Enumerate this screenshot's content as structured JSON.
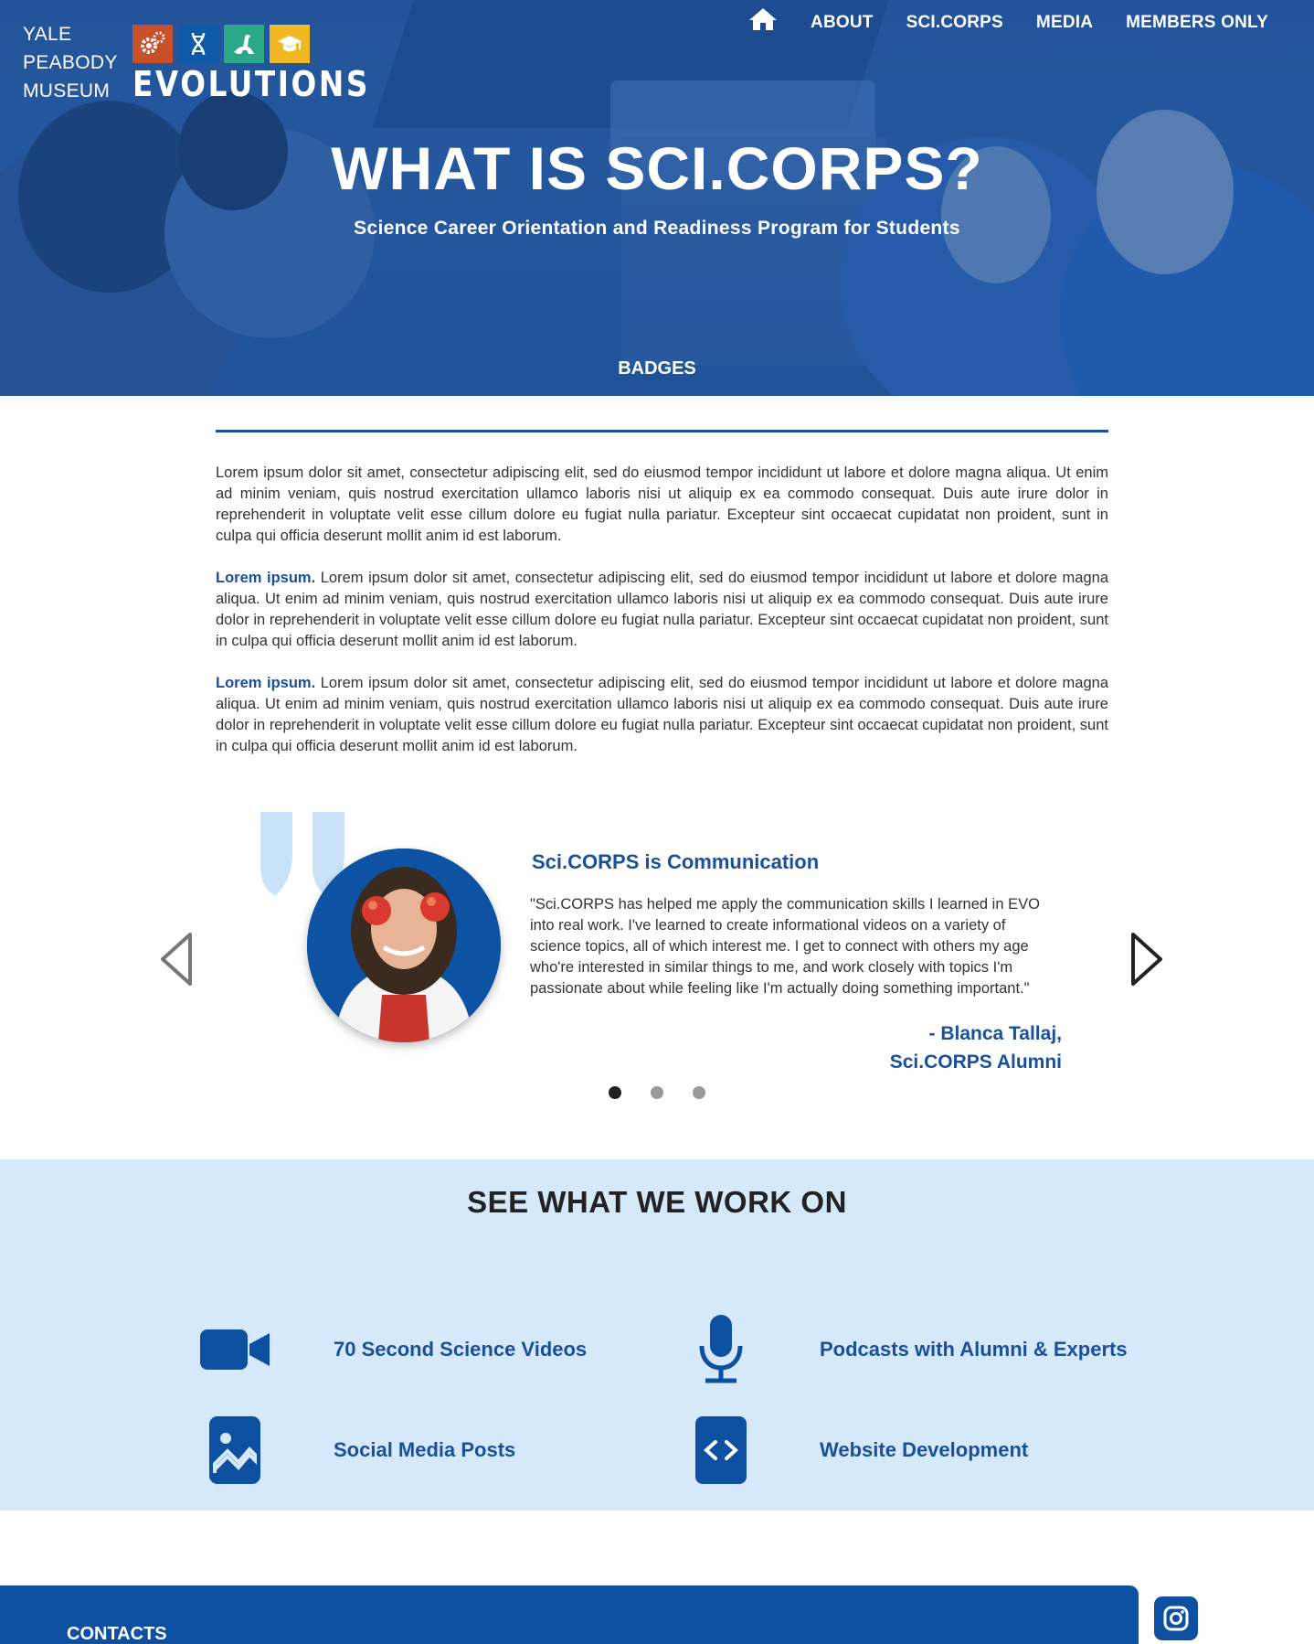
{
  "header": {
    "brand_lines": [
      "YALE",
      "PEABODY",
      "MUSEUM"
    ],
    "logo_word": "EVOLUTIONS",
    "tiles": [
      {
        "icon": "gears-icon",
        "color": "#c8502a"
      },
      {
        "icon": "dna-icon",
        "color": "#0e5aa8"
      },
      {
        "icon": "dinosaur-icon",
        "color": "#2aa887"
      },
      {
        "icon": "graduation-cap-icon",
        "color": "#f2b823"
      }
    ],
    "nav": {
      "home_icon": "home-icon",
      "items": [
        "ABOUT",
        "SCI.CORPS",
        "MEDIA",
        "MEMBERS ONLY"
      ]
    }
  },
  "hero": {
    "title": "WHAT IS SCI.CORPS?",
    "subtitle": "Science Career Orientation and Readiness Program for Students",
    "badges_label": "BADGES"
  },
  "intro": {
    "paragraph1": "Lorem ipsum dolor sit amet, consectetur adipiscing elit, sed do eiusmod tempor incididunt ut labore et dolore magna aliqua. Ut enim ad minim veniam, quis nostrud exercitation ullamco laboris nisi ut aliquip ex ea commodo consequat. Duis aute irure dolor in reprehenderit in voluptate velit esse cillum dolore eu fugiat nulla pariatur. Excepteur sint occaecat cupidatat non proident, sunt in culpa qui officia deserunt mollit anim id est laborum.",
    "paragraph2_lead": "Lorem ipsum.",
    "paragraph2": " Lorem ipsum dolor sit amet, consectetur adipiscing elit, sed do eiusmod tempor incididunt ut labore et dolore magna aliqua. Ut enim ad minim veniam, quis nostrud exercitation ullamco laboris nisi ut aliquip ex ea commodo consequat. Duis aute irure dolor in reprehenderit in voluptate velit esse cillum dolore eu fugiat nulla pariatur. Excepteur sint occaecat cupidatat non proident, sunt in culpa qui officia deserunt mollit anim id est laborum.",
    "paragraph3_lead": "Lorem ipsum.",
    "paragraph3": " Lorem ipsum dolor sit amet, consectetur adipiscing elit, sed do eiusmod tempor incididunt ut labore et dolore magna aliqua. Ut enim ad minim veniam, quis nostrud exercitation ullamco laboris nisi ut aliquip ex ea commodo consequat. Duis aute irure dolor in reprehenderit in voluptate velit esse cillum dolore eu fugiat nulla pariatur. Excepteur sint occaecat cupidatat non proident, sunt in culpa qui officia deserunt mollit anim id est laborum."
  },
  "testimonial": {
    "title": "Sci.CORPS is Communication",
    "quote": "\"Sci.CORPS has helped me apply the communication skills I learned in EVO into real work. I've learned to create informational videos on a variety of science topics, all of which interest me. I get to connect with others my age who're interested in similar things to me, and work closely with topics I'm passionate about while feeling like I'm actually doing something important.\"",
    "author_line1": "- Blanca Tallaj,",
    "author_line2": "Sci.CORPS Alumni",
    "slide_count": 3,
    "active_slide": 1
  },
  "work": {
    "title": "SEE WHAT WE WORK ON",
    "items": [
      {
        "label": "70 Second Science Videos",
        "icon": "video-camera-icon"
      },
      {
        "label": "Podcasts with Alumni & Experts",
        "icon": "microphone-icon"
      },
      {
        "label": "Social Media Posts",
        "icon": "image-icon"
      },
      {
        "label": "Website Development",
        "icon": "code-icon"
      }
    ]
  },
  "footer": {
    "title": "CONTACTS",
    "social_icon": "instagram-icon"
  },
  "colors": {
    "primary": "#1a4f9a",
    "footer": "#0d4fa0",
    "section_bg": "#d6e9fa",
    "quote_mark": "#c9e2f8"
  }
}
